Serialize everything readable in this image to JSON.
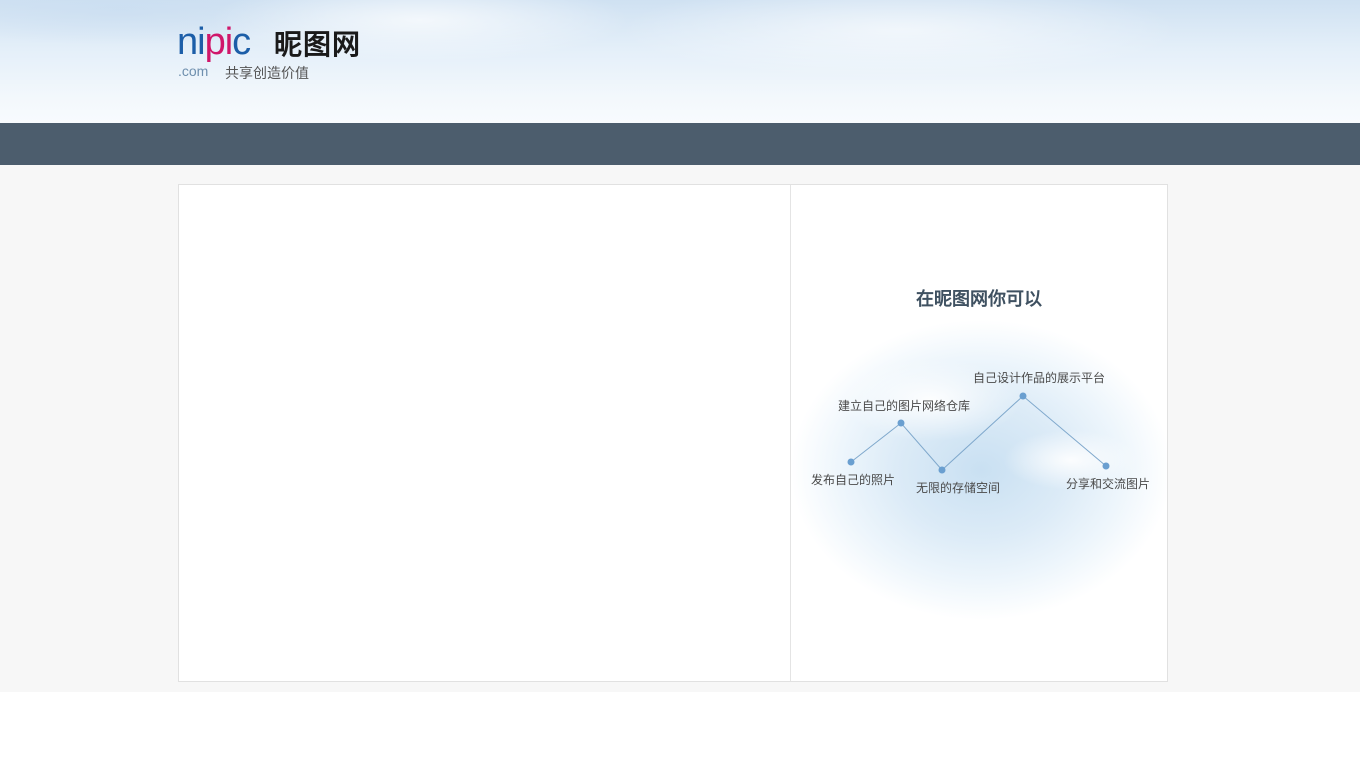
{
  "header": {
    "logo": {
      "brand_en_ni": "ni",
      "brand_en_pi": "pi",
      "brand_en_c": "c",
      "brand_cn": "昵图网",
      "domain": ".com",
      "slogan": "共享创造价值"
    }
  },
  "promo": {
    "title": "在昵图网你可以",
    "features": [
      "发布自己的照片",
      "建立自己的图片网络仓库",
      "无限的存储空间",
      "自己设计作品的展示平台",
      "分享和交流图片"
    ],
    "line_color": "#7fa8cc",
    "dot_color": "#6a9fd0"
  },
  "colors": {
    "navbar": "#4c5d6d",
    "brand_blue": "#1c5ea8",
    "brand_pink": "#d0166a"
  }
}
